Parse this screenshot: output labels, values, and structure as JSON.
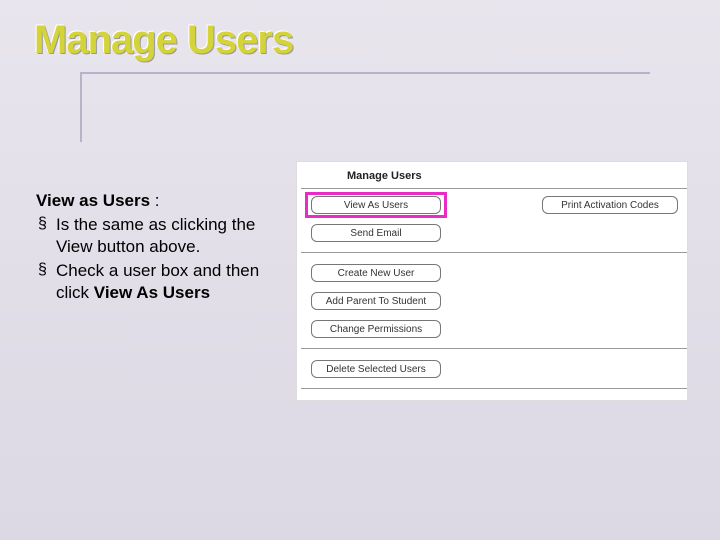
{
  "title": "Manage Users",
  "left": {
    "lead": "View as Users",
    "lead_suffix": " :",
    "bullets": [
      {
        "pre": "Is the same as clicking the View button above.",
        "bold": ""
      },
      {
        "pre": "Check a user box and then click ",
        "bold": "View As Users"
      }
    ]
  },
  "panel": {
    "heading": "Manage Users",
    "buttons": {
      "view_as_users": "View As Users",
      "print_codes": "Print Activation Codes",
      "send_email": "Send Email",
      "create_new_user": "Create New User",
      "add_parent": "Add Parent To Student",
      "change_permissions": "Change Permissions",
      "delete_selected": "Delete Selected Users"
    }
  }
}
